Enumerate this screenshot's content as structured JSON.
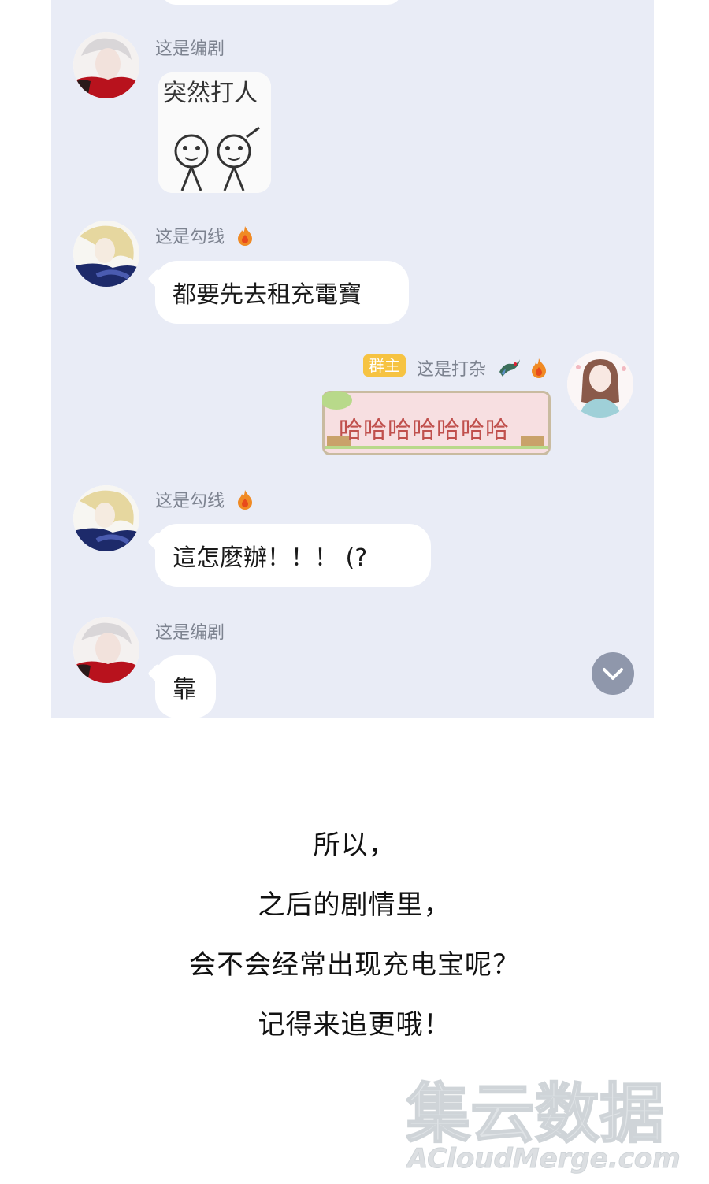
{
  "messages": [
    {
      "sender": "这是编剧",
      "type": "sticker",
      "sticker_text": "突然打人"
    },
    {
      "sender": "这是勾线",
      "type": "text",
      "text": "都要先去租充電寶"
    },
    {
      "sender": "这是打杂",
      "type": "card",
      "badge": "群主",
      "text": "哈哈哈哈哈哈哈"
    },
    {
      "sender": "这是勾线",
      "type": "text",
      "text": "這怎麼辦！！！ (?"
    },
    {
      "sender": "这是编剧",
      "type": "text",
      "text": "靠"
    }
  ],
  "caption": {
    "lines": [
      "所以，",
      "之后的剧情里，",
      "会不会经常出现充电宝呢？",
      "记得来追更哦！"
    ]
  },
  "watermark": {
    "main": "集云数据",
    "sub": "ACloudMerge.com"
  },
  "colors": {
    "chat_background": "#e9ecf6",
    "badge": "#f6c342",
    "card_text": "#c0504d"
  },
  "icons": [
    "fire-icon",
    "dragon-icon",
    "chevron-down-icon"
  ]
}
